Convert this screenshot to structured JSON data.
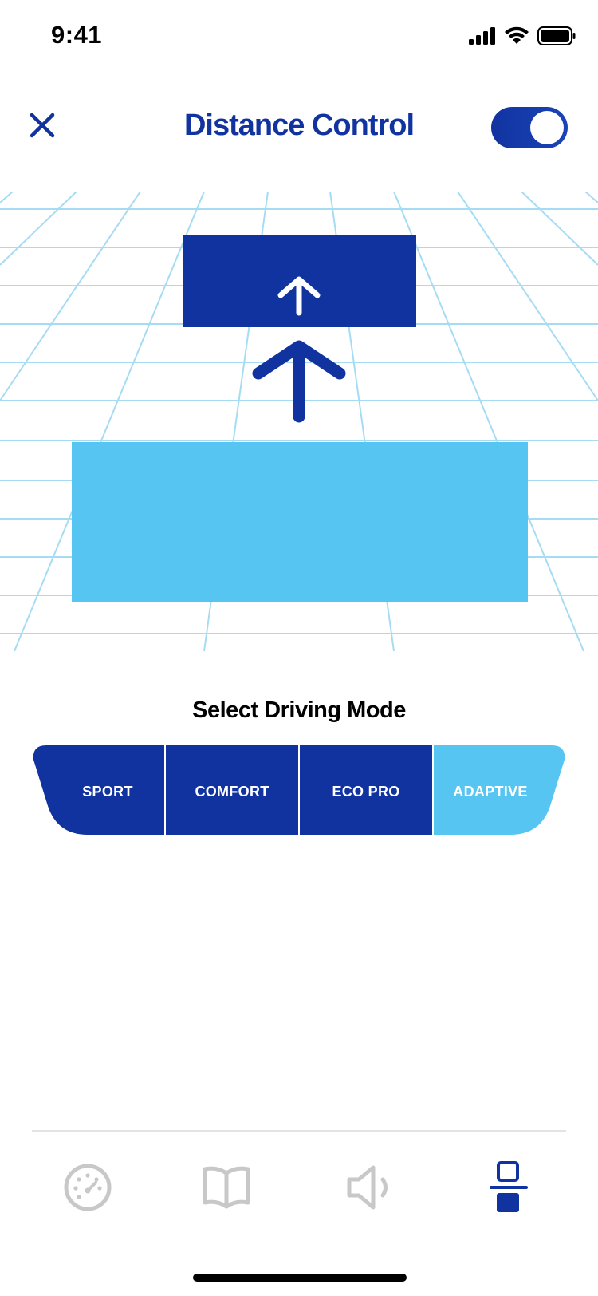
{
  "status_bar": {
    "time": "9:41"
  },
  "header": {
    "title": "Distance Control",
    "toggle_on": true
  },
  "mode_selector": {
    "title": "Select Driving Mode",
    "modes": [
      "SPORT",
      "COMFORT",
      "ECO PRO",
      "ADAPTIVE"
    ],
    "selected": "ADAPTIVE"
  },
  "colors": {
    "primary": "#1133a0",
    "accent": "#56c5f2",
    "grid": "#a6dcf3",
    "nav_inactive": "#c8c8c8"
  },
  "nav": {
    "items": [
      "speedometer-icon",
      "book-icon",
      "speaker-icon",
      "distance-icon"
    ],
    "active_index": 3
  }
}
